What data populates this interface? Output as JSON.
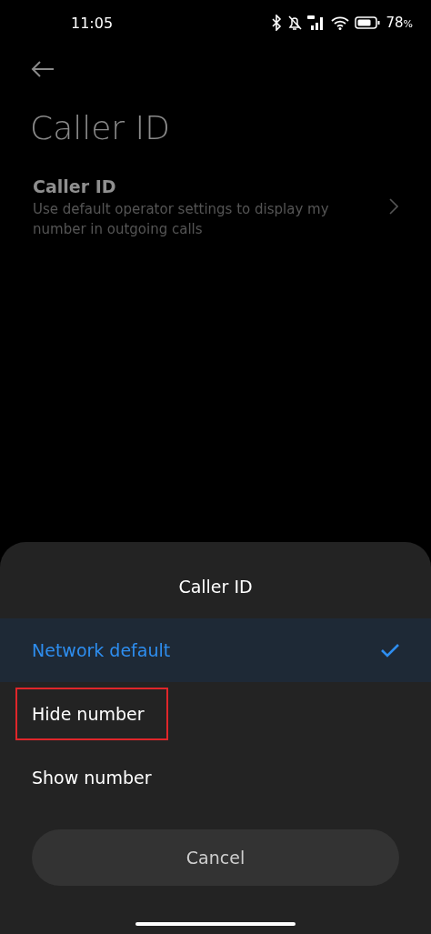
{
  "status_bar": {
    "time": "11:05",
    "battery": "78",
    "battery_unit": "%"
  },
  "page": {
    "title": "Caller ID"
  },
  "settings": [
    {
      "title": "Caller ID",
      "summary": "Use default operator settings to display my number in outgoing calls"
    }
  ],
  "dialog": {
    "title": "Caller ID",
    "options": [
      {
        "label": "Network default",
        "selected": true,
        "highlighted": false
      },
      {
        "label": "Hide number",
        "selected": false,
        "highlighted": true
      },
      {
        "label": "Show number",
        "selected": false,
        "highlighted": false
      }
    ],
    "buttons": [
      "Cancel"
    ]
  }
}
